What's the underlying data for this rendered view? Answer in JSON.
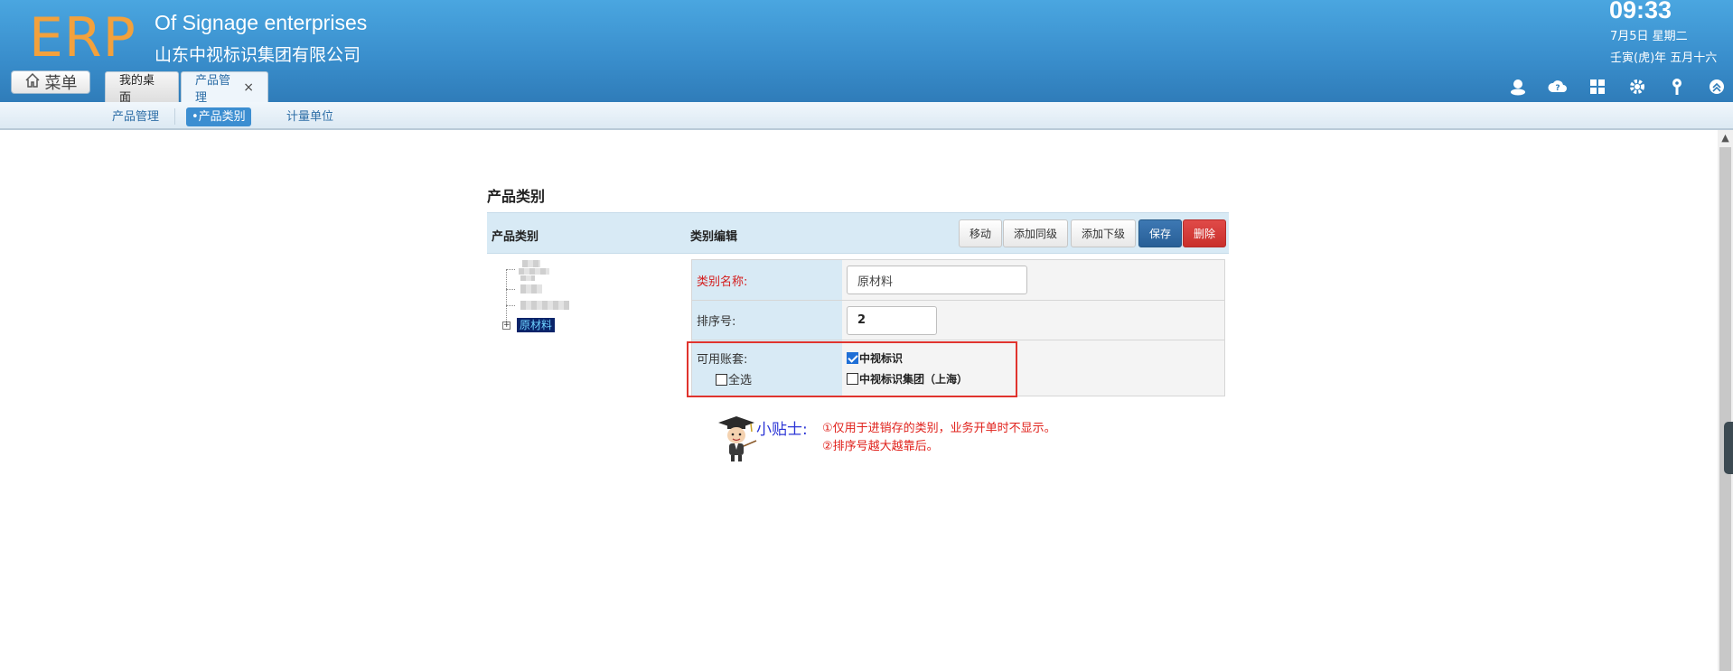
{
  "header": {
    "logo": "ERP",
    "company_en": "Of Signage enterprises",
    "company_cn": "山东中视标识集团有限公司",
    "time": "09:33",
    "date": "7月5日 星期二",
    "lunar": "壬寅(虎)年 五月十六",
    "menu_label": "菜单",
    "tabs": [
      {
        "label": "我的桌面"
      },
      {
        "label": "产品管理",
        "close": "×"
      }
    ]
  },
  "subnav": {
    "items": [
      {
        "label": "产品管理"
      },
      {
        "label": "•产品类别"
      },
      {
        "label": "计量单位"
      }
    ]
  },
  "page": {
    "title": "产品类别",
    "bar_left": "产品类别",
    "bar_mid": "类别编辑",
    "buttons": {
      "move": "移动",
      "add_sibling": "添加同级",
      "add_child": "添加下级",
      "save": "保存",
      "delete": "删除"
    },
    "tree": {
      "selected_node": "原材料",
      "toggle": "+"
    },
    "form": {
      "name_label": "类别名称:",
      "name_value": "原材料",
      "sort_label": "排序号:",
      "sort_value": "2",
      "accounts_label": "可用账套:",
      "select_all": "全选",
      "account1": "中视标识",
      "account2": "中视标识集团（上海）"
    },
    "tips": {
      "label": "小贴士:",
      "tip1": "①仅用于进销存的类别，业务开单时不显示。",
      "tip2": "②排序号越大越靠后。"
    }
  },
  "colors": {
    "header_blue": "#3a8fcd",
    "logo_orange": "#f3a13c",
    "primary": "#285f97",
    "danger": "#c9302c",
    "highlight_red": "#e0342e"
  }
}
